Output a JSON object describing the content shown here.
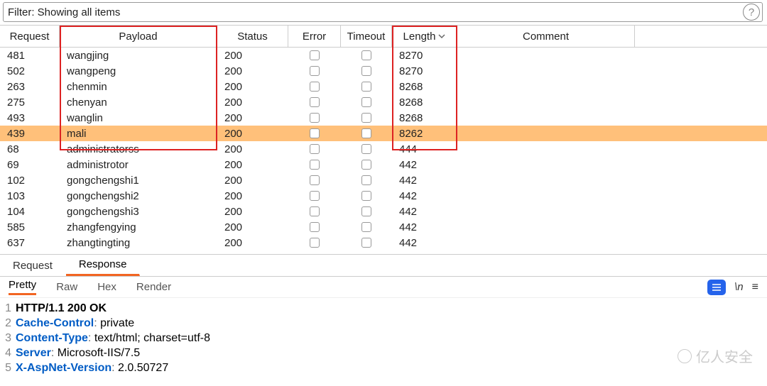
{
  "filter": {
    "text": "Filter: Showing all items"
  },
  "columns": {
    "request": "Request",
    "payload": "Payload",
    "status": "Status",
    "error": "Error",
    "timeout": "Timeout",
    "length": "Length",
    "comment": "Comment"
  },
  "rows": [
    {
      "request": "481",
      "payload": "wangjing",
      "status": "200",
      "length": "8270",
      "selected": false
    },
    {
      "request": "502",
      "payload": "wangpeng",
      "status": "200",
      "length": "8270",
      "selected": false
    },
    {
      "request": "263",
      "payload": "chenmin",
      "status": "200",
      "length": "8268",
      "selected": false
    },
    {
      "request": "275",
      "payload": "chenyan",
      "status": "200",
      "length": "8268",
      "selected": false
    },
    {
      "request": "493",
      "payload": "wanglin",
      "status": "200",
      "length": "8268",
      "selected": false
    },
    {
      "request": "439",
      "payload": "mali",
      "status": "200",
      "length": "8262",
      "selected": true
    },
    {
      "request": "68",
      "payload": "administratorss",
      "status": "200",
      "length": "444",
      "selected": false
    },
    {
      "request": "69",
      "payload": "administrotor",
      "status": "200",
      "length": "442",
      "selected": false
    },
    {
      "request": "102",
      "payload": "gongchengshi1",
      "status": "200",
      "length": "442",
      "selected": false
    },
    {
      "request": "103",
      "payload": "gongchengshi2",
      "status": "200",
      "length": "442",
      "selected": false
    },
    {
      "request": "104",
      "payload": "gongchengshi3",
      "status": "200",
      "length": "442",
      "selected": false
    },
    {
      "request": "585",
      "payload": "zhangfengying",
      "status": "200",
      "length": "442",
      "selected": false
    },
    {
      "request": "637",
      "payload": "zhangtingting",
      "status": "200",
      "length": "442",
      "selected": false
    }
  ],
  "tabs_reqres": {
    "request": "Request",
    "response": "Response"
  },
  "view_tabs": {
    "pretty": "Pretty",
    "raw": "Raw",
    "hex": "Hex",
    "render": "Render"
  },
  "newline_label": "\\n",
  "http_lines": [
    {
      "n": "1",
      "plain": "HTTP/1.1 200 OK"
    },
    {
      "n": "2",
      "header": "Cache-Control",
      "value": " private"
    },
    {
      "n": "3",
      "header": "Content-Type",
      "value": " text/html; charset=utf-8"
    },
    {
      "n": "4",
      "header": "Server",
      "value": " Microsoft-IIS/7.5"
    },
    {
      "n": "5",
      "header": "X-AspNet-Version",
      "value": " 2.0.50727"
    }
  ],
  "watermark": "亿人安全"
}
